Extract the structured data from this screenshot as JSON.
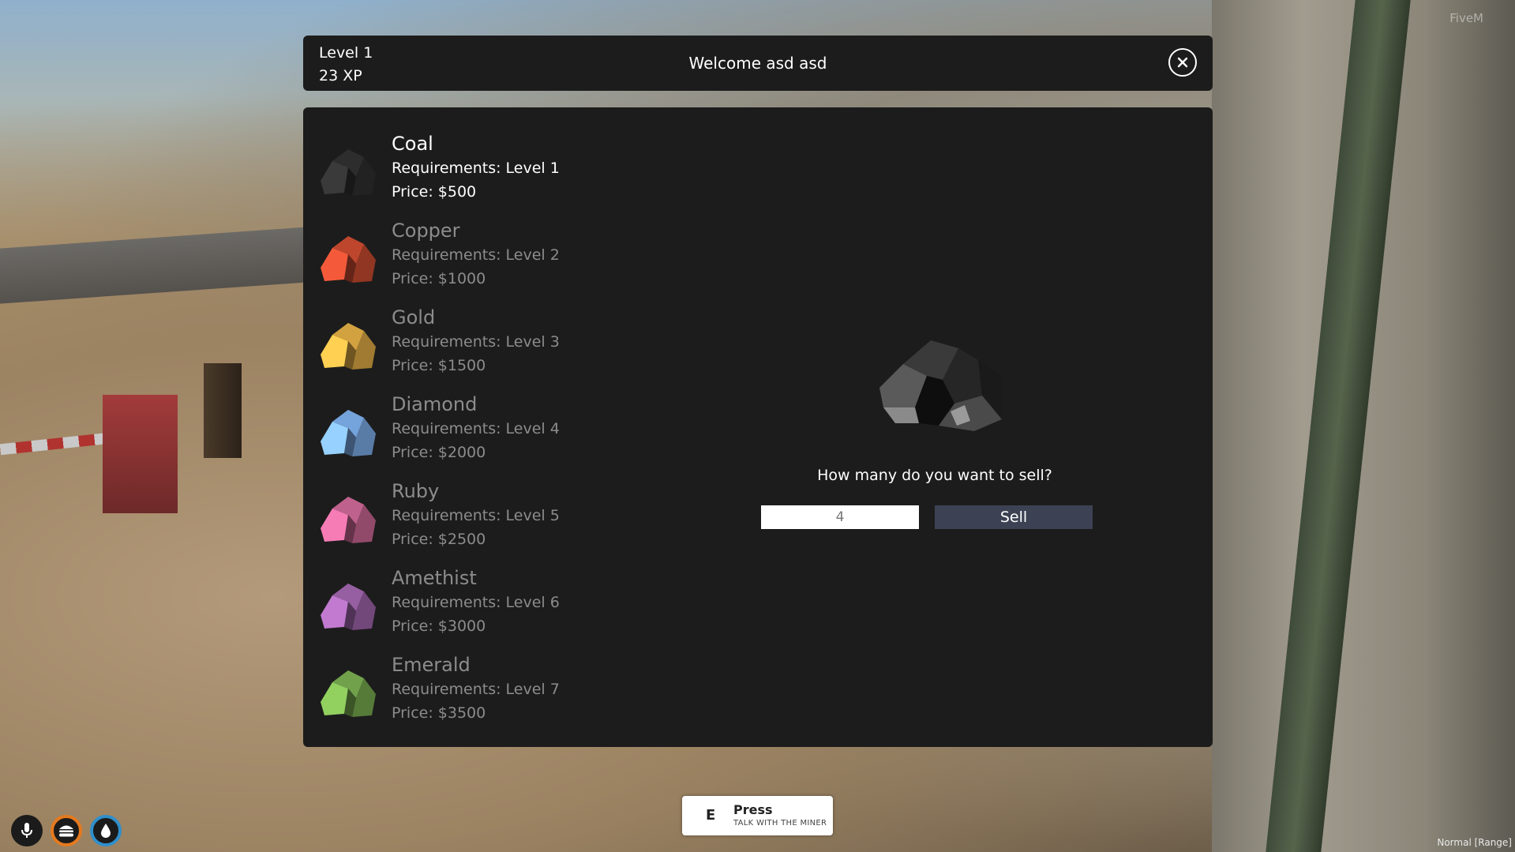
{
  "header": {
    "level": "Level 1",
    "xp": "23 XP",
    "welcome": "Welcome asd asd",
    "close_icon": "close-icon"
  },
  "ores": [
    {
      "name": "Coal",
      "requirement": "Requirements: Level 1",
      "price": "Price: $500",
      "color": "#2b2b2b",
      "active": true
    },
    {
      "name": "Copper",
      "requirement": "Requirements: Level 2",
      "price": "Price: $1000",
      "color": "#b5432b",
      "active": false
    },
    {
      "name": "Gold",
      "requirement": "Requirements: Level 3",
      "price": "Price: $1500",
      "color": "#c99a3d",
      "active": false
    },
    {
      "name": "Diamond",
      "requirement": "Requirements: Level 4",
      "price": "Price: $2000",
      "color": "#6f9bd1",
      "active": false
    },
    {
      "name": "Ruby",
      "requirement": "Requirements: Level 5",
      "price": "Price: $2500",
      "color": "#b65c86",
      "active": false
    },
    {
      "name": "Amethist",
      "requirement": "Requirements: Level 6",
      "price": "Price: $3000",
      "color": "#8f5a9a",
      "active": false
    },
    {
      "name": "Emerald",
      "requirement": "Requirements: Level 7",
      "price": "Price: $3500",
      "color": "#6c9a47",
      "active": false
    }
  ],
  "sell": {
    "question": "How many do you want to sell?",
    "quantity": "4",
    "button": "Sell"
  },
  "prompt": {
    "key": "E",
    "title": "Press",
    "subtitle": "TALK WITH THE MINER"
  },
  "hud": {
    "icons": [
      "microphone-icon",
      "hamburger-icon",
      "water-drop-icon"
    ]
  },
  "corner": {
    "top": "FiveM",
    "bottom": "Normal [Range]"
  }
}
